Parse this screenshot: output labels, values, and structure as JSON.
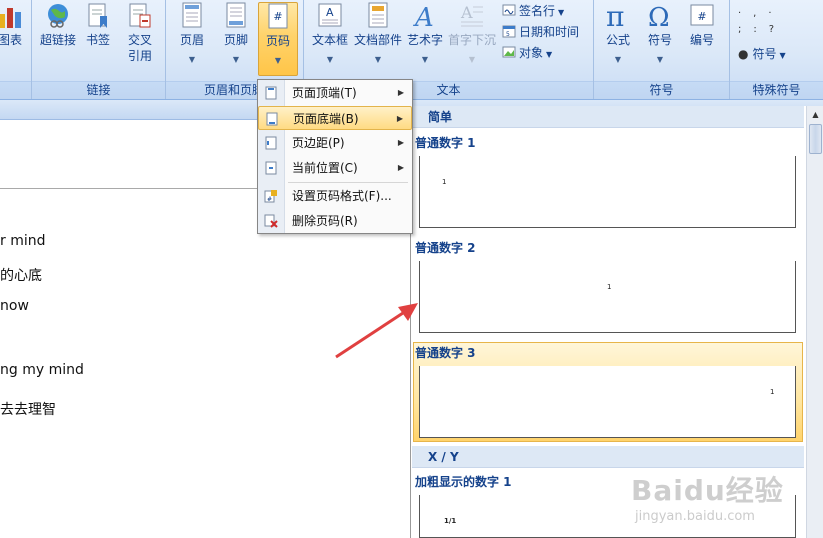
{
  "ribbon": {
    "partial_button": {
      "label": "图表"
    },
    "groups": {
      "links": {
        "label": "链接",
        "buttons": [
          {
            "label": "超链接",
            "icon": "globe-link-icon"
          },
          {
            "label": "书签",
            "icon": "bookmark-icon"
          },
          {
            "label_line1": "交叉",
            "label_line2": "引用",
            "icon": "cross-reference-icon"
          }
        ]
      },
      "header_footer": {
        "label": "页眉和页脚",
        "buttons": [
          {
            "label": "页眉",
            "icon": "header-icon"
          },
          {
            "label": "页脚",
            "icon": "footer-icon"
          },
          {
            "label": "页码",
            "icon": "page-number-icon",
            "active": true
          }
        ]
      },
      "text": {
        "label": "文本",
        "buttons": [
          {
            "label": "文本框",
            "icon": "text-box-icon"
          },
          {
            "label": "文档部件",
            "icon": "quick-parts-icon"
          },
          {
            "label": "艺术字",
            "icon": "wordart-icon"
          },
          {
            "label": "首字下沉",
            "icon": "drop-cap-icon",
            "disabled": true
          }
        ],
        "small_items": [
          {
            "label": "签名行",
            "icon": "signature-line-icon"
          },
          {
            "label": "日期和时间",
            "icon": "date-time-icon"
          },
          {
            "label": "对象",
            "icon": "object-icon"
          }
        ]
      },
      "symbols": {
        "label": "符号",
        "buttons": [
          {
            "label": "公式",
            "icon": "pi-icon"
          },
          {
            "label": "符号",
            "icon": "omega-icon"
          },
          {
            "label": "编号",
            "icon": "number-icon"
          }
        ]
      },
      "special_symbols": {
        "label": "特殊符号",
        "symbol_button": {
          "label": "符号"
        }
      }
    }
  },
  "document": {
    "lines": [
      "r mind",
      "的心底",
      "now",
      "ng my mind",
      "去去理智"
    ]
  },
  "page_number_menu": {
    "items": [
      {
        "label": "页面顶端(T)",
        "has_submenu": true
      },
      {
        "label": "页面底端(B)",
        "has_submenu": true,
        "highlighted": true
      },
      {
        "label": "页边距(P)",
        "has_submenu": true
      },
      {
        "label": "当前位置(C)",
        "has_submenu": true
      },
      {
        "label": "设置页码格式(F)...",
        "has_submenu": false
      },
      {
        "label": "删除页码(R)",
        "has_submenu": false
      }
    ]
  },
  "bottom_gallery": {
    "section_simple": "简单",
    "items": [
      {
        "title": "普通数字 1",
        "sample": "1",
        "align": "left"
      },
      {
        "title": "普通数字 2",
        "sample": "1",
        "align": "center"
      },
      {
        "title": "普通数字 3",
        "sample": "1",
        "align": "right",
        "selected": true
      }
    ],
    "section_xy": "X / Y",
    "xy_items": [
      {
        "title": "加粗显示的数字 1",
        "sample": "1/1"
      }
    ]
  },
  "watermark": {
    "logo": "Baidu经验",
    "url": "jingyan.baidu.com"
  },
  "colors": {
    "ribbon_text": "#15428b",
    "highlight": "#ffd36c",
    "annotation_arrow": "#e04040"
  }
}
